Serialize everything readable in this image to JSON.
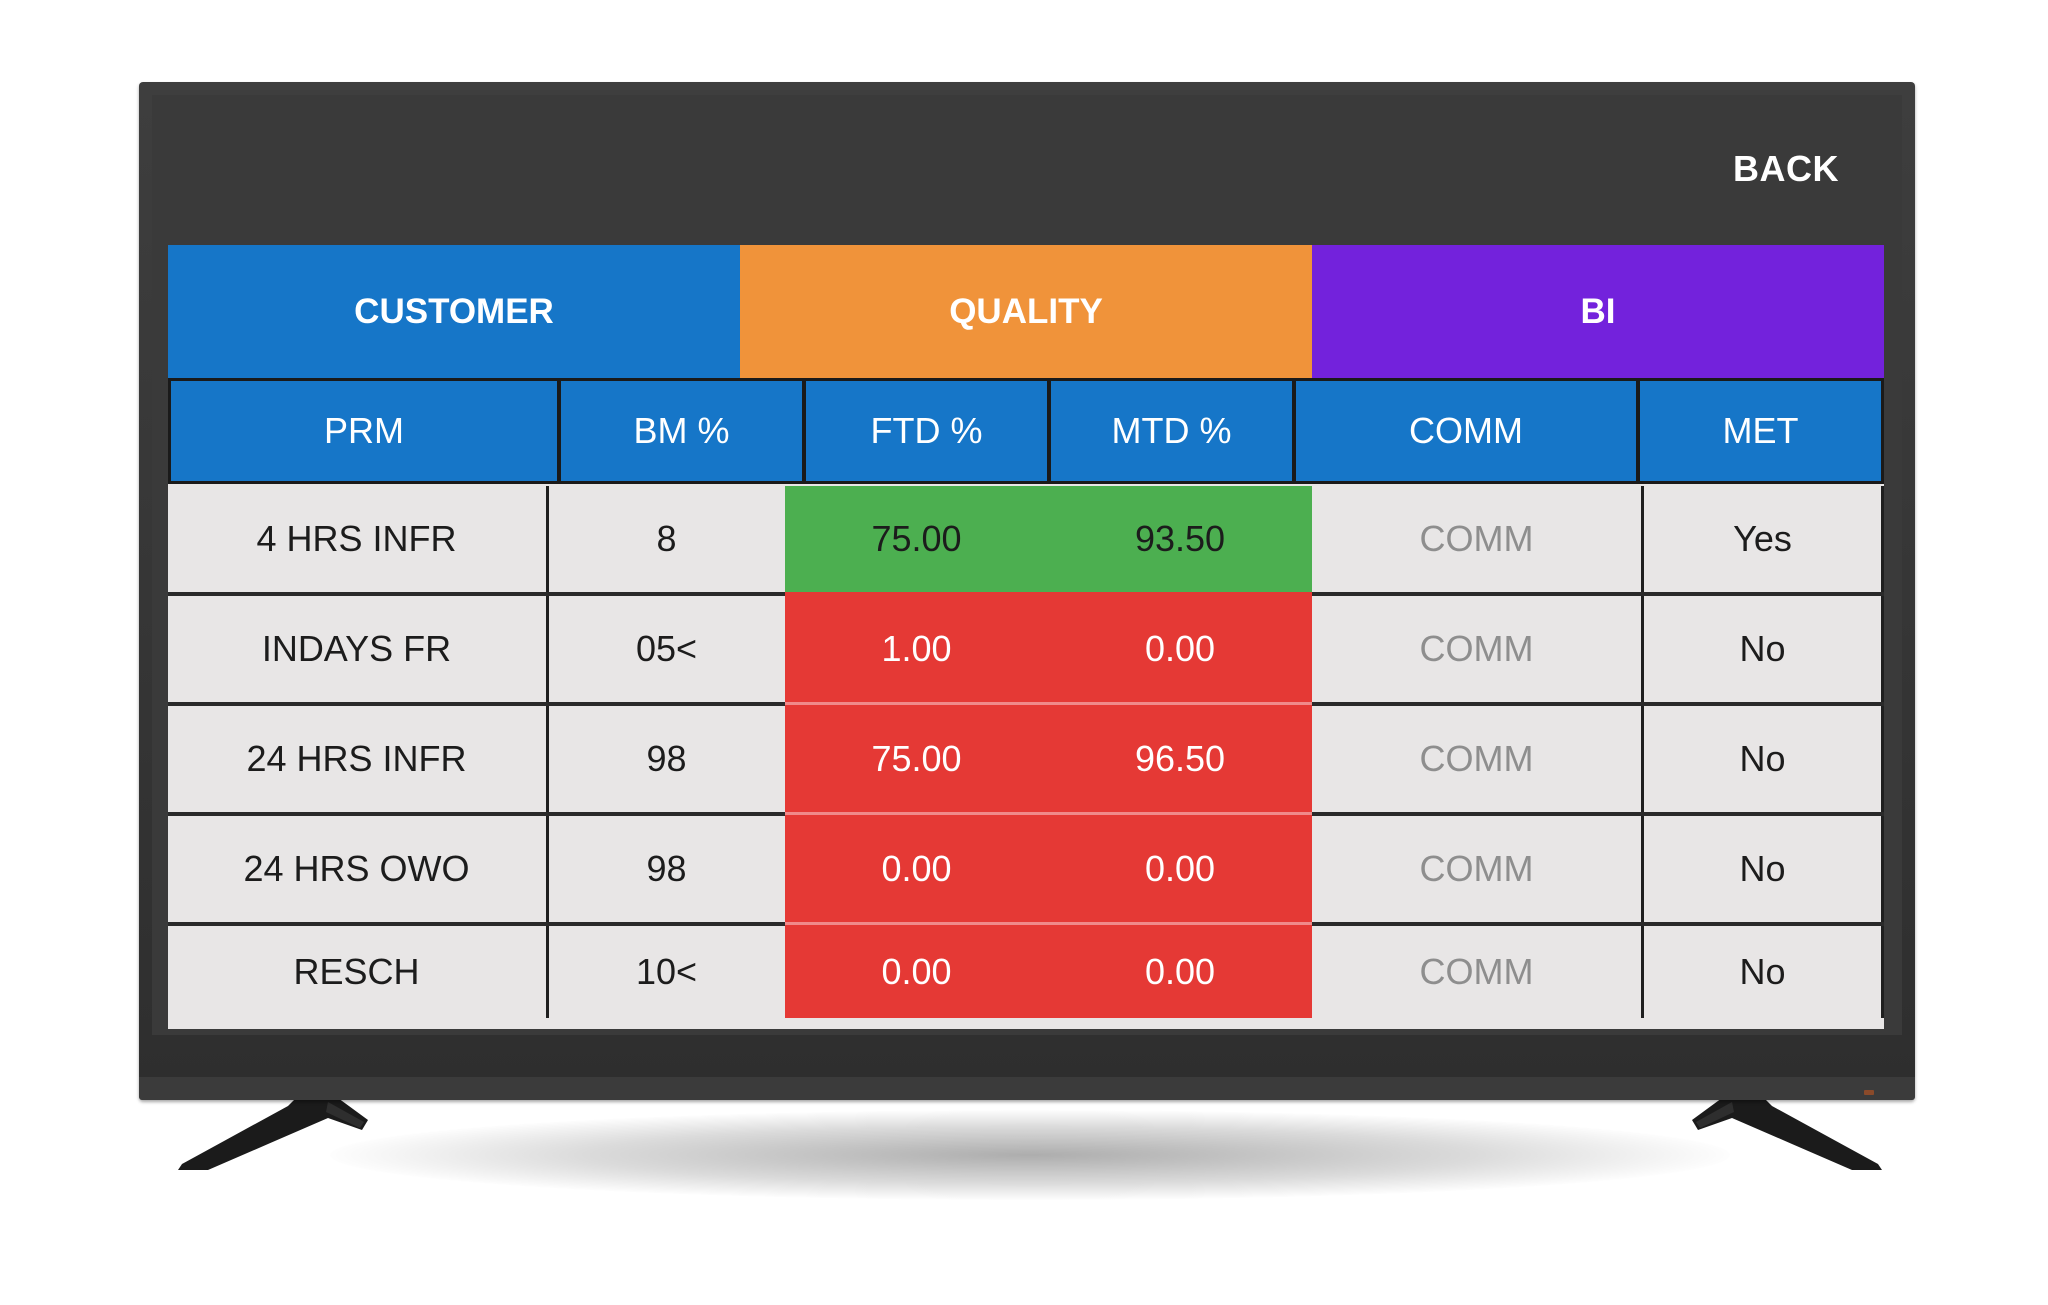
{
  "header": {
    "back_label": "BACK"
  },
  "tabs": [
    {
      "label": "CUSTOMER",
      "color": "#1676c8"
    },
    {
      "label": "QUALITY",
      "color": "#f0933a"
    },
    {
      "label": "BI",
      "color": "#7322dc"
    }
  ],
  "table": {
    "columns": [
      "PRM",
      "BM %",
      "FTD %",
      "MTD %",
      "COMM",
      "MET"
    ],
    "rows": [
      {
        "prm": "4 HRS INFR",
        "bm": "8",
        "ftd": "75.00",
        "mtd": "93.50",
        "comm": "COMM",
        "met": "Yes",
        "status": "met"
      },
      {
        "prm": "INDAYS FR",
        "bm": "05<",
        "ftd": "1.00",
        "mtd": "0.00",
        "comm": "COMM",
        "met": "No",
        "status": "not-met"
      },
      {
        "prm": "24 HRS INFR",
        "bm": "98",
        "ftd": "75.00",
        "mtd": "96.50",
        "comm": "COMM",
        "met": "No",
        "status": "not-met"
      },
      {
        "prm": "24 HRS OWO",
        "bm": "98",
        "ftd": "0.00",
        "mtd": "0.00",
        "comm": "COMM",
        "met": "No",
        "status": "not-met"
      },
      {
        "prm": "RESCH",
        "bm": "10<",
        "ftd": "0.00",
        "mtd": "0.00",
        "comm": "COMM",
        "met": "No",
        "status": "not-met"
      }
    ]
  },
  "colors": {
    "met": "#4caf50",
    "not_met": "#e53935",
    "header_blue": "#1676c8",
    "cell_gray": "#e8e6e6",
    "screen_bg": "#3a3a3a"
  }
}
